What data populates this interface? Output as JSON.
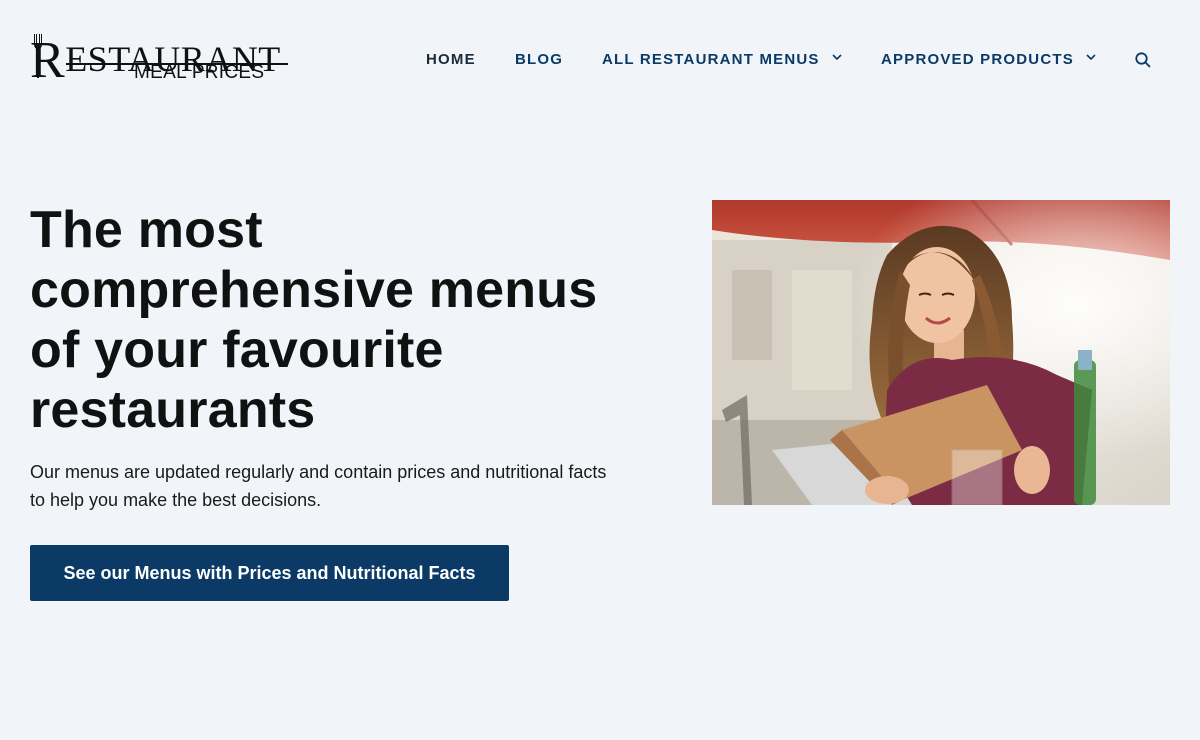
{
  "logo": {
    "main_first": "R",
    "main_rest": "ESTAURANT",
    "sub": "MEAL PRICES"
  },
  "nav": {
    "items": [
      {
        "label": "HOME",
        "has_dropdown": false
      },
      {
        "label": "BLOG",
        "has_dropdown": false
      },
      {
        "label": "ALL RESTAURANT MENUS",
        "has_dropdown": true
      },
      {
        "label": "APPROVED PRODUCTS",
        "has_dropdown": true
      }
    ],
    "search_icon": "search-icon"
  },
  "hero": {
    "title": "The most comprehensive menus of your favourite restaurants",
    "subtitle": "Our menus are updated regularly and contain prices and nutritional facts to help you make the best decisions.",
    "cta_label": "See our Menus with Prices and Nutritional Facts"
  },
  "colors": {
    "background": "#f1f5f9",
    "accent": "#0b3a66",
    "text": "#111111",
    "nav_home": "#1b2a3a"
  }
}
